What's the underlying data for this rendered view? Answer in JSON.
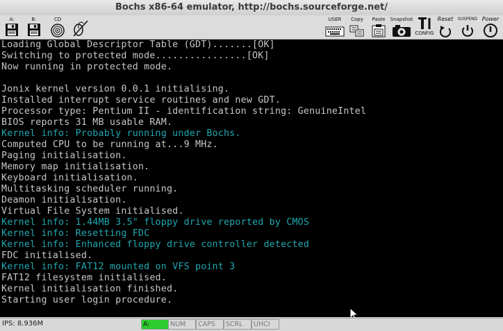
{
  "window": {
    "title": "Bochs x86-64 emulator, http://bochs.sourceforge.net/"
  },
  "toolbar": {
    "left_buttons": [
      {
        "label": "A:",
        "icon": "floppy-a-icon"
      },
      {
        "label": "B:",
        "icon": "floppy-b-icon"
      },
      {
        "label": "CD",
        "icon": "cdrom-icon"
      },
      {
        "label": "",
        "icon": "mouse-disabled-icon"
      }
    ],
    "right_buttons": [
      {
        "label": "USER",
        "icon": "user-keyboard-icon"
      },
      {
        "label": "Copy",
        "icon": "copy-icon"
      },
      {
        "label": "Paste",
        "icon": "paste-icon"
      },
      {
        "label": "Snapshot",
        "icon": "snapshot-icon"
      },
      {
        "label": "CONFIG",
        "icon": "config-icon"
      },
      {
        "label": "Reset",
        "icon": "reset-icon"
      },
      {
        "label": "SUSPEND",
        "icon": "suspend-icon"
      },
      {
        "label": "Power",
        "icon": "power-icon"
      }
    ]
  },
  "console": {
    "lines": [
      {
        "text": "Loading Global Descriptor Table (GDT).......[OK]",
        "color": "#c8c8c8"
      },
      {
        "text": "Switching to protected mode................[OK]",
        "color": "#c8c8c8"
      },
      {
        "text": "Now running in protected mode.",
        "color": "#c8c8c8"
      },
      {
        "text": "",
        "color": "#c8c8c8"
      },
      {
        "text": "Jonix kernel version 0.0.1 initialising.",
        "color": "#c8c8c8"
      },
      {
        "text": "Installed interrupt service routines and new GDT.",
        "color": "#c8c8c8"
      },
      {
        "text": "Processor type: Pentium II - identification string: GenuineIntel",
        "color": "#c8c8c8"
      },
      {
        "text": "BIOS reports 31 MB usable RAM.",
        "color": "#c8c8c8"
      },
      {
        "text": "Kernel info: Probably running under Bochs.",
        "color": "#20a8b0"
      },
      {
        "text": "Computed CPU to be running at...9 MHz.",
        "color": "#c8c8c8"
      },
      {
        "text": "Paging initialisation.",
        "color": "#c8c8c8"
      },
      {
        "text": "Memory map initialisation.",
        "color": "#c8c8c8"
      },
      {
        "text": "Keyboard initialisation.",
        "color": "#c8c8c8"
      },
      {
        "text": "Multitasking scheduler running.",
        "color": "#c8c8c8"
      },
      {
        "text": "Deamon initialisation.",
        "color": "#c8c8c8"
      },
      {
        "text": "Virtual File System initialised.",
        "color": "#c8c8c8"
      },
      {
        "text": "Kernel info: 1.44MB 3.5\" floppy drive reported by CMOS",
        "color": "#20a8b0"
      },
      {
        "text": "Kernel info: Resetting FDC",
        "color": "#20a8b0"
      },
      {
        "text": "Kernel info: Enhanced floppy drive controller detected",
        "color": "#20a8b0"
      },
      {
        "text": "FDC initialised.",
        "color": "#c8c8c8"
      },
      {
        "text": "Kernel info: FAT12 mounted on VFS point 3",
        "color": "#20a8b0"
      },
      {
        "text": "FAT12 filesystem initialised.",
        "color": "#c8c8c8"
      },
      {
        "text": "Kernel initialisation finished.",
        "color": "#c8c8c8"
      },
      {
        "text": "Starting user login procedure.",
        "color": "#c8c8c8"
      }
    ]
  },
  "statusbar": {
    "ips": "IPS: 8.936M",
    "indicators": [
      {
        "label": "A:",
        "active": true
      },
      {
        "label": "NUM",
        "active": false
      },
      {
        "label": "CAPS",
        "active": false
      },
      {
        "label": "SCRL",
        "active": false
      },
      {
        "label": "UHCI",
        "active": false
      }
    ]
  },
  "colors": {
    "console_bg": "#000000",
    "console_fg": "#c8c8c8",
    "console_info": "#20a8b0",
    "led_active": "#2ecc2e"
  }
}
